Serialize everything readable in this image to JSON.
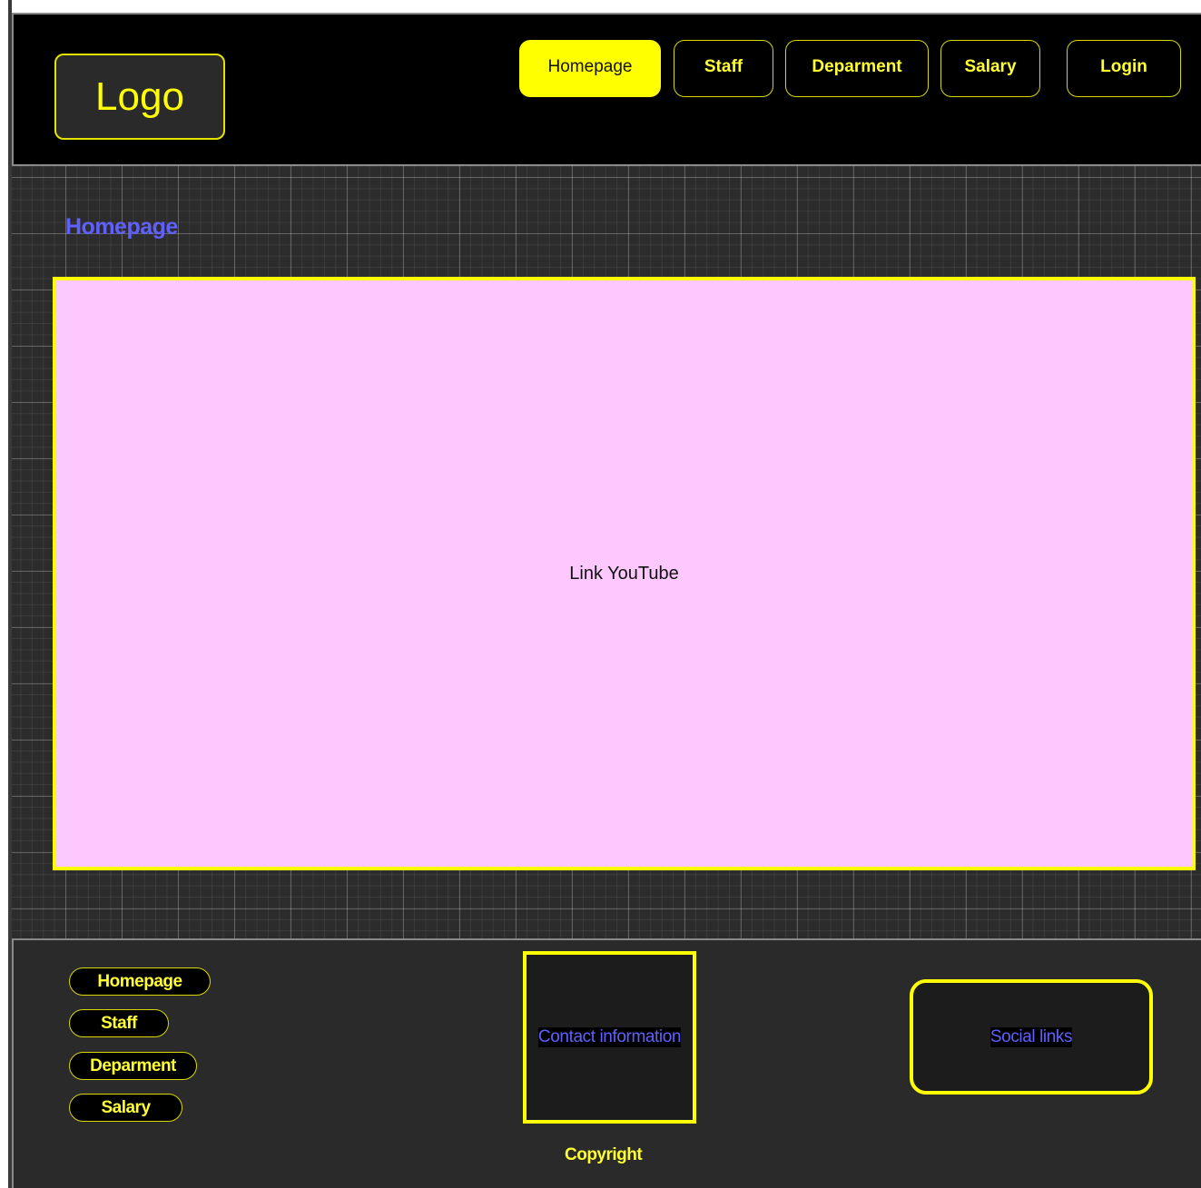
{
  "header": {
    "logo": "Logo",
    "nav": [
      {
        "label": "Homepage",
        "active": true
      },
      {
        "label": "Staff",
        "active": false
      },
      {
        "label": "Deparment",
        "active": false
      },
      {
        "label": "Salary",
        "active": false
      },
      {
        "label": "Login",
        "active": false
      }
    ]
  },
  "main": {
    "page_title": "Homepage",
    "video_placeholder": "Link YouTube"
  },
  "footer": {
    "links": [
      "Homepage",
      "Staff",
      "Deparment",
      "Salary"
    ],
    "contact": "Contact information",
    "social": "Social links",
    "copyright": "Copyright"
  },
  "colors": {
    "accent": "#ffff00",
    "title": "#6060ff",
    "video_bg": "#fdc8fd",
    "header_bg": "#000000"
  }
}
